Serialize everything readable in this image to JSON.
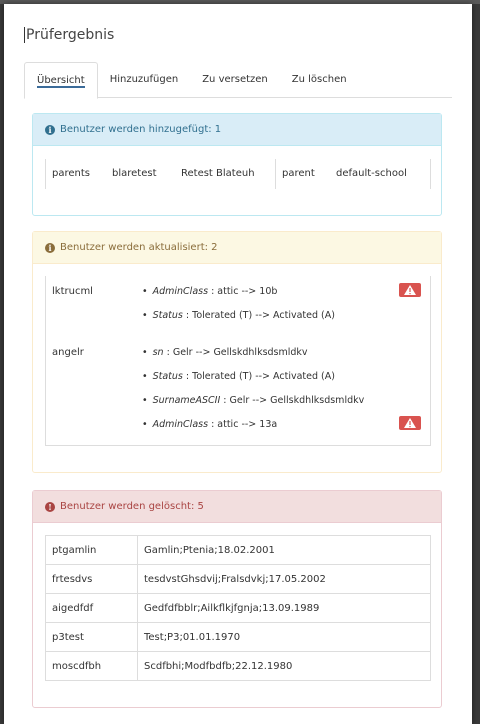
{
  "title": "Prüfergebnis",
  "tabs": [
    "Übersicht",
    "Hinzuzufügen",
    "Zu versetzen",
    "Zu löschen"
  ],
  "added": {
    "heading": "Benutzer werden hinzugefügt: 1",
    "row": [
      "parents",
      "blaretest",
      "Retest Blateuh",
      "parent",
      "default-school"
    ]
  },
  "updated": {
    "heading": "Benutzer werden aktualisiert: 2",
    "users": [
      {
        "name": "lktrucml",
        "changes": [
          {
            "field": "AdminClass",
            "text": " : attic --> 10b",
            "warn": true
          },
          {
            "field": "Status",
            "text": " : Tolerated (T) --> Activated (A)",
            "warn": false
          }
        ]
      },
      {
        "name": "angelr",
        "changes": [
          {
            "field": "sn",
            "text": " : Gelr --> Gellskdhlksdsmldkv",
            "warn": false
          },
          {
            "field": "Status",
            "text": " : Tolerated (T) --> Activated (A)",
            "warn": false
          },
          {
            "field": "SurnameASCII",
            "text": " : Gelr --> Gellskdhlksdsmldkv",
            "warn": false
          },
          {
            "field": "AdminClass",
            "text": " : attic --> 13a",
            "warn": true
          }
        ]
      }
    ]
  },
  "deleted": {
    "heading": "Benutzer werden gelöscht: 5",
    "rows": [
      [
        "ptgamlin",
        "Gamlin;Ptenia;18.02.2001"
      ],
      [
        "frtesdvs",
        "tesdvstGhsdvij;Fralsdvkj;17.05.2002"
      ],
      [
        "aigedfdf",
        "Gedfdfbblr;Ailkflkjfgnja;13.09.1989"
      ],
      [
        "p3test",
        "Test;P3;01.01.1970"
      ],
      [
        "moscdfbh",
        "Scdfbhi;Modfbdfb;22.12.1980"
      ]
    ]
  },
  "colors": {
    "info": "#31708f",
    "warning": "#8a6d3b",
    "danger": "#a94442",
    "alert_badge": "#d9534f"
  }
}
